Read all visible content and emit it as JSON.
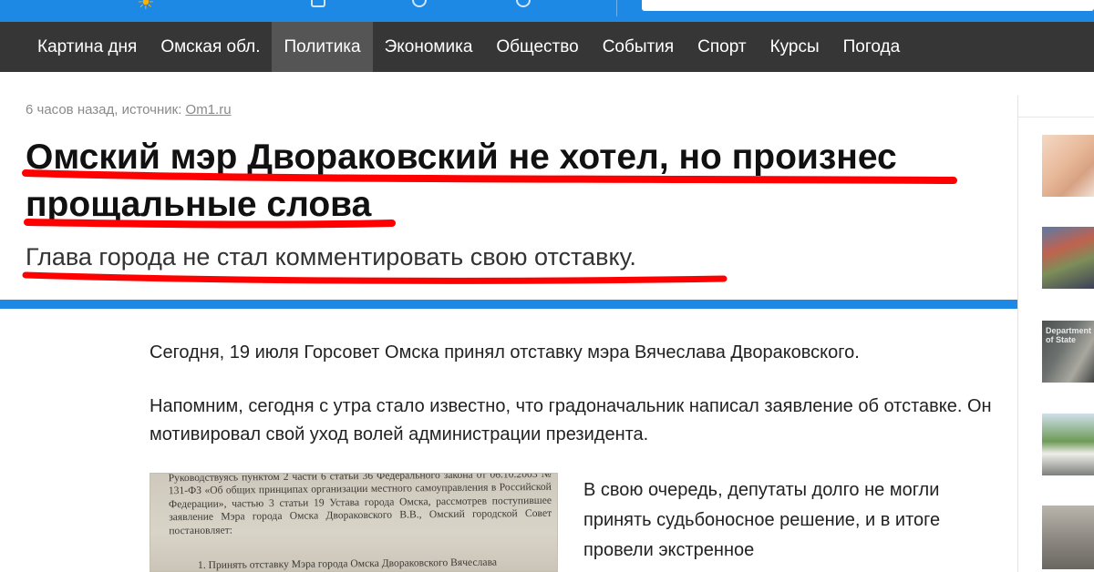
{
  "header": {
    "logo_icon": "sun-logo-icon",
    "icons": [
      "mail-icon",
      "location-icon",
      "user-icon"
    ],
    "accent_color": "#1e88e5"
  },
  "nav": {
    "items": [
      {
        "label": "Картина дня",
        "active": false
      },
      {
        "label": "Омская обл.",
        "active": false
      },
      {
        "label": "Политика",
        "active": true
      },
      {
        "label": "Экономика",
        "active": false
      },
      {
        "label": "Общество",
        "active": false
      },
      {
        "label": "События",
        "active": false
      },
      {
        "label": "Спорт",
        "active": false
      },
      {
        "label": "Курсы",
        "active": false
      },
      {
        "label": "Погода",
        "active": false
      }
    ],
    "background_color": "#363636"
  },
  "article": {
    "meta_time": "6 часов назад, источник: ",
    "meta_source": "Om1.ru",
    "headline": "Омский мэр Двораковский не хотел, но произнес прощальные слова",
    "subheadline": "Глава города не стал комментировать свою отставку.",
    "paragraphs": [
      "Сегодня, 19 июля Горсовет Омска принял отставку мэра Вячеслава Двораковского.",
      "Напомним, сегодня с утра стало известно, что градоначальник написал заявление об отставке. Он мотивировал свой уход волей администрации президента.",
      "В свою очередь, депутаты долго не могли принять судьбоносное решение, и в итоге провели экстренное"
    ],
    "document_image": {
      "text": "Руководствуясь пунктом 2 части 6 статьи 36 Федерального закона от 06.10.2003 № 131-ФЗ «Об общих принципах организации местного самоуправления в Российской Федерации», частью 3 статьи 19 Устава города Омска, рассмотрев поступившее заявление Мэра города Омска Двораковского В.В., Омский городской Совет постановляет:",
      "item": "1. Принять отставку Мэра города Омска Двораковского Вячеслава"
    },
    "highlight_color": "#ff0000"
  },
  "sidebar": {
    "thumbnails": [
      {
        "name": "thumb-spa-woman"
      },
      {
        "name": "thumb-crowd"
      },
      {
        "name": "thumb-department-of-state",
        "text": "Department of State"
      },
      {
        "name": "thumb-trailer"
      },
      {
        "name": "thumb-street"
      }
    ]
  }
}
